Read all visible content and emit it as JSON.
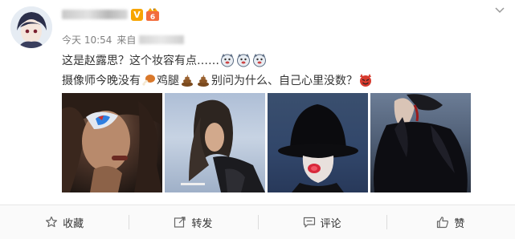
{
  "post": {
    "user": {
      "name_visible": "一 刂"
    },
    "meta": {
      "time": "今天 10:54",
      "source_prefix": "来自"
    },
    "text": {
      "line1": "这是赵露思？这个妆容有点……",
      "line2_a": "摄像师今晚没有",
      "line2_b": "鸡腿",
      "line2_c": "别问为什么、自己心里没数？"
    },
    "emoji": [
      "doge-icon",
      "doge-icon",
      "doge-icon",
      "chicken-leg-icon",
      "poop-icon",
      "poop-icon",
      "devil-icon"
    ]
  },
  "actions": {
    "favorite": "收藏",
    "repost": "转发",
    "comment": "评论",
    "like": "赞"
  },
  "colors": {
    "badge_orange": "#f7a500",
    "muted": "#808080",
    "text": "#333333"
  }
}
